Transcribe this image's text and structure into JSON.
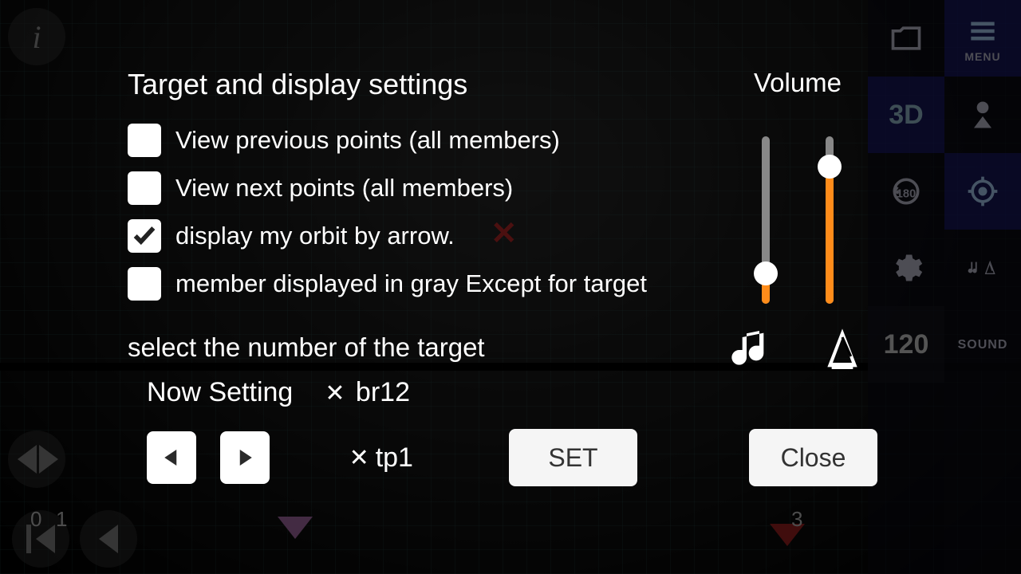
{
  "modal": {
    "title": "Target and display settings",
    "options": [
      {
        "label": "View previous points (all members)",
        "checked": false
      },
      {
        "label": "View next points (all members)",
        "checked": false
      },
      {
        "label": "display my orbit by arrow.",
        "checked": true
      },
      {
        "label": "member displayed in gray Except for target",
        "checked": false
      }
    ],
    "select_label": "select the number of the target",
    "now_label": "Now Setting",
    "now_value": "br12",
    "current_value": "tp1",
    "set_label": "SET",
    "close_label": "Close"
  },
  "volume": {
    "title": "Volume",
    "music_percent": 18,
    "metronome_percent": 82
  },
  "right1": {
    "view3d": "3D",
    "tempo": "120"
  },
  "right2": {
    "menu": "MENU",
    "sound": "SOUND"
  },
  "bg": {
    "count0": "0",
    "count1": "1",
    "count3": "3"
  }
}
